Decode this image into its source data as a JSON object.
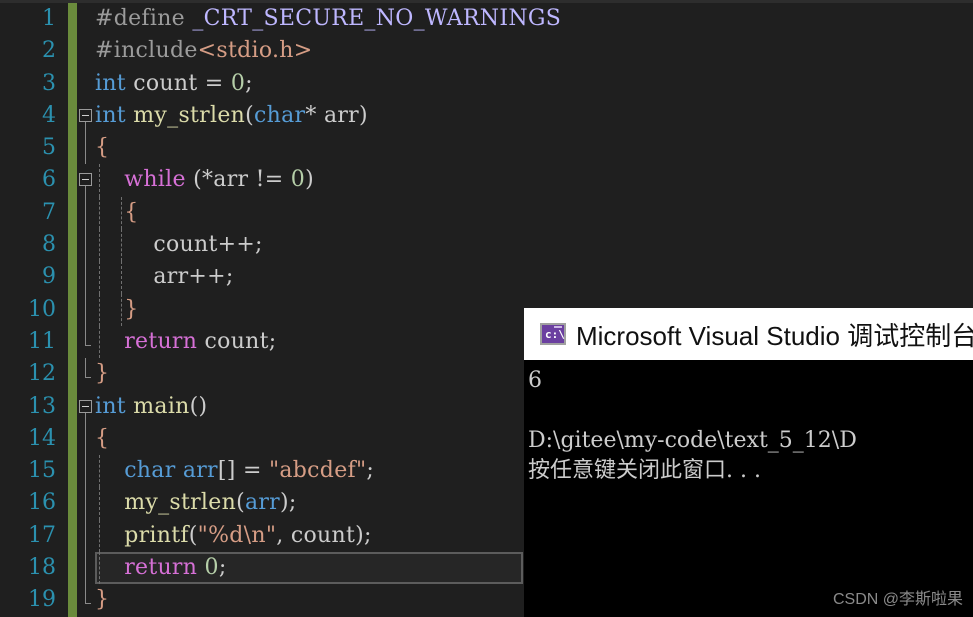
{
  "editor": {
    "name": "visual-studio-code-editor",
    "background": "#1f1f1f",
    "linenumber_color": "#2b91af",
    "changebar_color": "#6a8b3c",
    "current_line": 18,
    "lines": [
      {
        "number": "1",
        "indent": 0,
        "fold": "none",
        "tokens": [
          {
            "text": "#define",
            "cls": "t-pp"
          },
          {
            "text": " ",
            "cls": "t-plain"
          },
          {
            "text": "_CRT_SECURE_NO_WARNINGS",
            "cls": "t-macro"
          }
        ]
      },
      {
        "number": "2",
        "indent": 0,
        "fold": "none",
        "tokens": [
          {
            "text": "#include",
            "cls": "t-pp"
          },
          {
            "text": "<stdio.h>",
            "cls": "t-str"
          }
        ]
      },
      {
        "number": "3",
        "indent": 0,
        "fold": "none",
        "tokens": [
          {
            "text": "int",
            "cls": "k-blue"
          },
          {
            "text": " count ",
            "cls": "t-plain"
          },
          {
            "text": "=",
            "cls": "t-punct"
          },
          {
            "text": " ",
            "cls": "t-plain"
          },
          {
            "text": "0",
            "cls": "t-num"
          },
          {
            "text": ";",
            "cls": "t-punct"
          }
        ]
      },
      {
        "number": "4",
        "indent": 0,
        "fold": "box",
        "tokens": [
          {
            "text": "int",
            "cls": "k-blue"
          },
          {
            "text": " ",
            "cls": "t-plain"
          },
          {
            "text": "my_strlen",
            "cls": "t-fn"
          },
          {
            "text": "(",
            "cls": "t-punct"
          },
          {
            "text": "char",
            "cls": "k-blue"
          },
          {
            "text": "*",
            "cls": "t-punct"
          },
          {
            "text": " arr",
            "cls": "t-plain"
          },
          {
            "text": ")",
            "cls": "t-punct"
          }
        ]
      },
      {
        "number": "5",
        "indent": 0,
        "fold": "line",
        "tokens": [
          {
            "text": "{",
            "cls": "t-str"
          }
        ]
      },
      {
        "number": "6",
        "indent": 1,
        "fold": "box",
        "tokens": [
          {
            "text": "    ",
            "cls": "t-plain"
          },
          {
            "text": "while",
            "cls": "k-pink"
          },
          {
            "text": " (",
            "cls": "t-punct"
          },
          {
            "text": "*",
            "cls": "t-punct"
          },
          {
            "text": "arr ",
            "cls": "t-plain"
          },
          {
            "text": "!=",
            "cls": "t-punct"
          },
          {
            "text": " ",
            "cls": "t-plain"
          },
          {
            "text": "0",
            "cls": "t-num"
          },
          {
            "text": ")",
            "cls": "t-punct"
          }
        ]
      },
      {
        "number": "7",
        "indent": 2,
        "fold": "line",
        "tokens": [
          {
            "text": "    ",
            "cls": "t-plain"
          },
          {
            "text": "{",
            "cls": "t-str"
          }
        ]
      },
      {
        "number": "8",
        "indent": 2,
        "fold": "line",
        "tokens": [
          {
            "text": "        count",
            "cls": "t-plain"
          },
          {
            "text": "++;",
            "cls": "t-punct"
          }
        ]
      },
      {
        "number": "9",
        "indent": 2,
        "fold": "line",
        "tokens": [
          {
            "text": "        arr",
            "cls": "t-plain"
          },
          {
            "text": "++;",
            "cls": "t-punct"
          }
        ]
      },
      {
        "number": "10",
        "indent": 2,
        "fold": "line",
        "tokens": [
          {
            "text": "    ",
            "cls": "t-plain"
          },
          {
            "text": "}",
            "cls": "t-str"
          }
        ]
      },
      {
        "number": "11",
        "indent": 1,
        "fold": "end",
        "tokens": [
          {
            "text": "    ",
            "cls": "t-plain"
          },
          {
            "text": "return",
            "cls": "k-pink"
          },
          {
            "text": " count",
            "cls": "t-plain"
          },
          {
            "text": ";",
            "cls": "t-punct"
          }
        ]
      },
      {
        "number": "12",
        "indent": 0,
        "fold": "endouter",
        "tokens": [
          {
            "text": "}",
            "cls": "t-str"
          }
        ]
      },
      {
        "number": "13",
        "indent": 0,
        "fold": "box",
        "tokens": [
          {
            "text": "int",
            "cls": "k-blue"
          },
          {
            "text": " ",
            "cls": "t-plain"
          },
          {
            "text": "main",
            "cls": "t-fn"
          },
          {
            "text": "()",
            "cls": "t-punct"
          }
        ]
      },
      {
        "number": "14",
        "indent": 0,
        "fold": "line",
        "tokens": [
          {
            "text": "{",
            "cls": "t-str"
          }
        ]
      },
      {
        "number": "15",
        "indent": 1,
        "fold": "line",
        "tokens": [
          {
            "text": "    ",
            "cls": "t-plain"
          },
          {
            "text": "char",
            "cls": "k-blue"
          },
          {
            "text": " ",
            "cls": "t-plain"
          },
          {
            "text": "arr",
            "cls": "k-blue"
          },
          {
            "text": "[] ",
            "cls": "t-punct"
          },
          {
            "text": "=",
            "cls": "t-punct"
          },
          {
            "text": " ",
            "cls": "t-plain"
          },
          {
            "text": "\"abcdef\"",
            "cls": "t-str"
          },
          {
            "text": ";",
            "cls": "t-punct"
          }
        ]
      },
      {
        "number": "16",
        "indent": 1,
        "fold": "line",
        "tokens": [
          {
            "text": "    ",
            "cls": "t-plain"
          },
          {
            "text": "my_strlen",
            "cls": "t-fn"
          },
          {
            "text": "(",
            "cls": "t-punct"
          },
          {
            "text": "arr",
            "cls": "k-blue"
          },
          {
            "text": ");",
            "cls": "t-punct"
          }
        ]
      },
      {
        "number": "17",
        "indent": 1,
        "fold": "line",
        "tokens": [
          {
            "text": "    ",
            "cls": "t-plain"
          },
          {
            "text": "printf",
            "cls": "t-fn"
          },
          {
            "text": "(",
            "cls": "t-punct"
          },
          {
            "text": "\"%d\\n\"",
            "cls": "t-str"
          },
          {
            "text": ", count",
            "cls": "t-plain"
          },
          {
            "text": ");",
            "cls": "t-punct"
          }
        ]
      },
      {
        "number": "18",
        "indent": 1,
        "fold": "line",
        "tokens": [
          {
            "text": "    ",
            "cls": "t-plain"
          },
          {
            "text": "return",
            "cls": "k-pink"
          },
          {
            "text": " ",
            "cls": "t-plain"
          },
          {
            "text": "0",
            "cls": "t-num"
          },
          {
            "text": ";",
            "cls": "t-punct"
          }
        ]
      },
      {
        "number": "19",
        "indent": 0,
        "fold": "endouter",
        "tokens": [
          {
            "text": "}",
            "cls": "t-str"
          }
        ]
      }
    ]
  },
  "console": {
    "window_name": "visual-studio-debug-console",
    "title": "Microsoft Visual Studio 调试控制台",
    "icon": "console-cmd-icon",
    "icon_glyph": "c:\\",
    "icon_color": "#6b3fa0",
    "titlebar_background": "#ffffff",
    "background": "#000000",
    "output_lines": [
      "6",
      "",
      "D:\\gitee\\my-code\\text_5_12\\D",
      "按任意键关闭此窗口. . ."
    ]
  },
  "watermark": {
    "text": "CSDN @李斯啦果"
  }
}
